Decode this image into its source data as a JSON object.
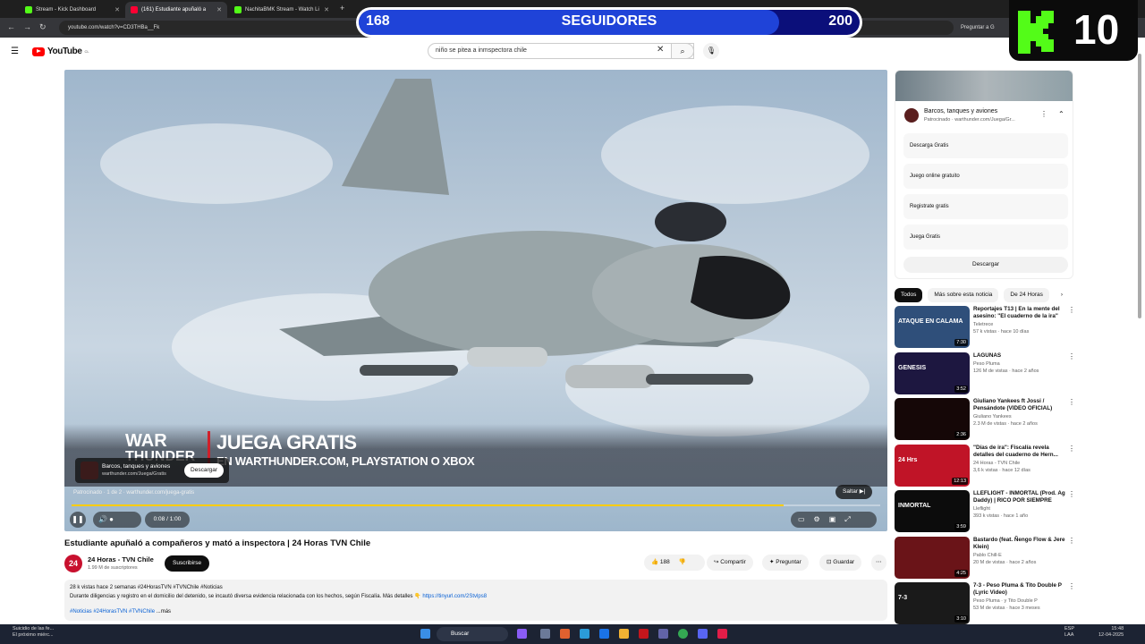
{
  "browser": {
    "tabs": [
      {
        "label": "Stream - Kick Dashboard",
        "color": "#53fc18",
        "active": false
      },
      {
        "label": "(161) Estudiante apuñaló a",
        "color": "#ff0033",
        "active": true
      },
      {
        "label": "NachitaBMK Stream - Watch Li",
        "color": "#53fc18",
        "active": false
      }
    ],
    "url": "youtube.com/watch?v=CD3THBa__Fk",
    "ask_gemini": "Preguntar a G"
  },
  "overlay": {
    "followers_label": "SEGUIDORES",
    "current": "168",
    "goal": "200",
    "progress_fraction": 0.84,
    "kick_count": "10"
  },
  "youtube": {
    "logo_text": "YouTube",
    "country": "CL",
    "search_value": "niño se pitea a inmspectora chile"
  },
  "player": {
    "ad_title": "JUEGA GRATIS",
    "ad_subtitle": "EN WARTHUNDER.COM, PLAYSTATION O XBOX",
    "ad_logo_line1": "WAR",
    "ad_logo_line2": "THUNDER",
    "adcard_title": "Barcos, tanques y aviones",
    "adcard_url": "warthunder.com/Juega/Gratis",
    "adcard_button": "Descargar",
    "ad_info": "Patrocinado · 1 de 2 · warthunder.com/juega-gratis",
    "skip": "Saltar",
    "time": "0:08 / 1:00",
    "progress_fraction": 0.88
  },
  "video": {
    "title": "Estudiante apuñaló a compañeros y mató a inspectora | 24 Horas TVN Chile",
    "channel": "24 Horas - TVN Chile",
    "channel_avatar": "24",
    "subscribers": "1.99 M de suscriptores",
    "subscribe": "Suscribirse",
    "likes": "188",
    "share": "Compartir",
    "ask": "Preguntar",
    "save": "Guardar",
    "desc_line1": "28 k vistas  hace 2 semanas  #24HorasTVN #TVNChile #Noticias",
    "desc_line2": "Durante diligencias y registro en el domicilio del detenido, se incautó diversa evidencia relacionada con los hechos, según Fiscalía. Más detalles 👇",
    "desc_link": "https://tinyurl.com/2Stvlps8",
    "desc_tags": "#Noticias #24HorasTVN #TVNChile",
    "desc_more": "...más"
  },
  "sidebar": {
    "ad": {
      "title": "Barcos, tanques y aviones",
      "sponsored": "Patrocinado · warthunder.com/Juega/Gr...",
      "links": [
        "Descarga Gratis",
        "Juego online gratuito",
        "Registrate gratis",
        "Juega Gratis"
      ],
      "button": "Descargar"
    },
    "chips": [
      "Todos",
      "Más sobre esta noticia",
      "De 24 Horas"
    ],
    "recommendations": [
      {
        "title": "Reportajes T13 | En la mente del asesino: \"El cuaderno de la ira\"",
        "channel": "Teletrece",
        "meta": "57 k vistas · hace 10 días",
        "duration": "7:30",
        "thumb": "#2f4f7a",
        "thumb_text": "ATAQUE EN CALAMA"
      },
      {
        "title": "LAGUNAS",
        "channel": "Peso Pluma",
        "meta": "126 M de vistas · hace 2 años",
        "duration": "3:52",
        "thumb": "#1d1740",
        "thumb_text": "GENESIS"
      },
      {
        "title": "Giuliano Yankees ft Jossi / Pensándote (VIDEO OFICIAL)",
        "channel": "Giuliano Yankees",
        "meta": "2.3 M de vistas · hace 2 años",
        "duration": "2:36",
        "thumb": "#150707",
        "thumb_text": ""
      },
      {
        "title": "\"Días de ira\": Fiscalía revela detalles del cuaderno de Hern...",
        "channel": "24 Horas - TVN Chile",
        "meta": "3,6 k vistas · hace 12 días",
        "duration": "12:13",
        "thumb": "#c01427",
        "thumb_text": "24 Hrs"
      },
      {
        "title": "LLEFLIGHT - INMORTAL (Prod. Ag Daddy) | RICO POR SIEMPRE",
        "channel": "Lleflight",
        "meta": "393 k vistas · hace 1 año",
        "duration": "3:59",
        "thumb": "#0c0c0c",
        "thumb_text": "INMORTAL"
      },
      {
        "title": "Bastardo (feat. Ñengo Flow & Jere Klein)",
        "channel": "Pablo Chill-E",
        "meta": "20 M de vistas · hace 2 años",
        "duration": "4:25",
        "thumb": "#6a1418",
        "thumb_text": ""
      },
      {
        "title": "7-3 - Peso Pluma & Tito Double P (Lyric Video)",
        "channel": "Peso Pluma · y Tito Double P",
        "meta": "53 M de vistas · hace 3 meses",
        "duration": "3:10",
        "thumb": "#1a1a1a",
        "thumb_text": "7-3"
      }
    ]
  },
  "taskbar": {
    "news_line1": "Suicidio de las fe...",
    "news_line2": "El próximo miérc...",
    "search": "Buscar",
    "lang_line1": "ESP",
    "lang_line2": "LAA",
    "time": "15:48",
    "date": "12-04-2025"
  }
}
